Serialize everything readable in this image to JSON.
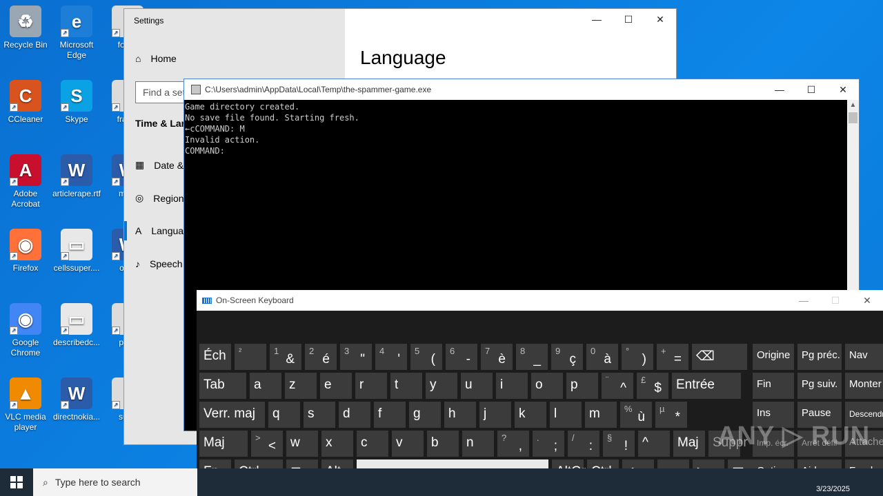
{
  "desktop": {
    "icons": [
      {
        "label": "Recycle Bin"
      },
      {
        "label": "Microsoft Edge"
      },
      {
        "label": "focus"
      },
      {
        "label": "CCleaner"
      },
      {
        "label": "Skype"
      },
      {
        "label": "frame"
      },
      {
        "label": "Adobe Acrobat"
      },
      {
        "label": "articlerape.rtf"
      },
      {
        "label": "minu"
      },
      {
        "label": "Firefox"
      },
      {
        "label": "cellssuper...."
      },
      {
        "label": "offer"
      },
      {
        "label": "Google Chrome"
      },
      {
        "label": "describedc..."
      },
      {
        "label": "pack"
      },
      {
        "label": "VLC media player"
      },
      {
        "label": "directnokia..."
      },
      {
        "label": "subn"
      }
    ]
  },
  "settings": {
    "title": "Settings",
    "home": "Home",
    "search_placeholder": "Find a setting",
    "section": "Time & Language",
    "nav": [
      "Date & time",
      "Region",
      "Language",
      "Speech"
    ],
    "page_title": "Language"
  },
  "console": {
    "title": "C:\\Users\\admin\\AppData\\Local\\Temp\\the-spammer-game.exe",
    "lines": "Game directory created.\nNo save file found. Starting fresh.\n←cCOMMAND: M\nInvalid action.\nCOMMAND:"
  },
  "osk": {
    "title": "On-Screen Keyboard",
    "rows": {
      "r1": [
        {
          "m": "Éch"
        },
        {
          "s": "²"
        },
        {
          "s": "1",
          "b": "&"
        },
        {
          "s": "2",
          "b": "é"
        },
        {
          "s": "3",
          "b": "\""
        },
        {
          "s": "4",
          "b": "'"
        },
        {
          "s": "5",
          "b": "("
        },
        {
          "s": "6",
          "b": "-"
        },
        {
          "s": "7",
          "b": "è"
        },
        {
          "s": "8",
          "b": "_"
        },
        {
          "s": "9",
          "b": "ç"
        },
        {
          "s": "0",
          "b": "à"
        },
        {
          "s": "°",
          "b": ")"
        },
        {
          "s": "+",
          "b": "="
        },
        {
          "m": "⌫"
        }
      ],
      "r2": [
        {
          "m": "Tab"
        },
        {
          "m": "a"
        },
        {
          "m": "z"
        },
        {
          "m": "e"
        },
        {
          "m": "r"
        },
        {
          "m": "t"
        },
        {
          "m": "y"
        },
        {
          "m": "u"
        },
        {
          "m": "i"
        },
        {
          "m": "o"
        },
        {
          "m": "p"
        },
        {
          "s": "¨",
          "b": "^"
        },
        {
          "s": "£",
          "b": "$"
        },
        {
          "m": "Entrée"
        }
      ],
      "r3": [
        {
          "m": "Verr. maj"
        },
        {
          "m": "q"
        },
        {
          "m": "s"
        },
        {
          "m": "d"
        },
        {
          "m": "f"
        },
        {
          "m": "g"
        },
        {
          "m": "h"
        },
        {
          "m": "j"
        },
        {
          "m": "k"
        },
        {
          "m": "l"
        },
        {
          "m": "m"
        },
        {
          "s": "%",
          "b": "ù"
        },
        {
          "s": "µ",
          "b": "*"
        }
      ],
      "r4": [
        {
          "m": "Maj"
        },
        {
          "s": ">",
          "b": "<"
        },
        {
          "m": "w"
        },
        {
          "m": "x"
        },
        {
          "m": "c"
        },
        {
          "m": "v"
        },
        {
          "m": "b"
        },
        {
          "m": "n"
        },
        {
          "s": "?",
          "b": ","
        },
        {
          "s": ".",
          "b": ";"
        },
        {
          "s": "/",
          "b": ":"
        },
        {
          "s": "§",
          "b": "!"
        },
        {
          "m": "^"
        },
        {
          "m": "Maj"
        },
        {
          "m": "Suppr"
        }
      ],
      "r5": [
        {
          "m": "Fn"
        },
        {
          "m": "Ctrl"
        },
        {
          "m": "⊞"
        },
        {
          "m": "Alt"
        },
        {
          "m": ""
        },
        {
          "m": "AltGr"
        },
        {
          "m": "Ctrl"
        },
        {
          "m": "<"
        },
        {
          "m": "∨"
        },
        {
          "m": ">"
        },
        {
          "m": "▤"
        }
      ]
    },
    "nav_keys": [
      [
        "Origine",
        "Pg préc.",
        "Nav"
      ],
      [
        "Fin",
        "Pg suiv.",
        "Monter"
      ],
      [
        "Ins",
        "Pause",
        "Descendre"
      ],
      [
        "Imp. écr.",
        "Arrêt défil",
        "Attacher"
      ],
      [
        "Options",
        "Aide",
        "Fondu"
      ]
    ]
  },
  "taskbar": {
    "search_placeholder": "Type here to search",
    "date": "3/23/2025"
  },
  "watermark": "ANY ▷ RUN"
}
